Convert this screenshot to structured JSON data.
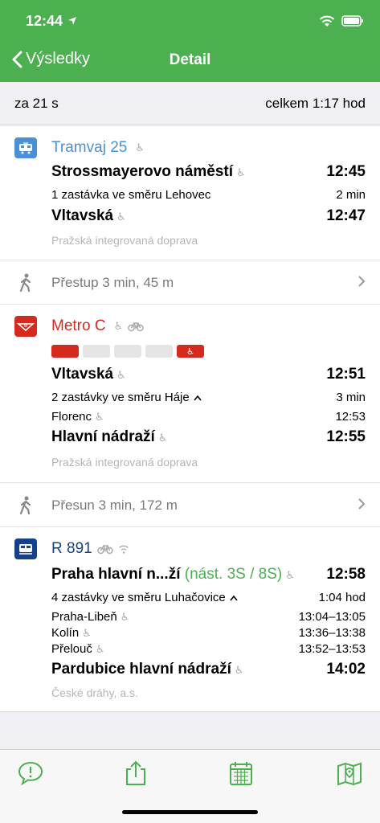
{
  "status": {
    "time": "12:44"
  },
  "nav": {
    "back_label": "Výsledky",
    "title": "Detail"
  },
  "summary": {
    "departure_in": "za 21 s",
    "total": "celkem 1:17 hod"
  },
  "legs": [
    {
      "type": "tram",
      "line": "Tramvaj 25",
      "line_color": "#4a90d9",
      "from": "Strossmayerovo náměstí",
      "from_time": "12:45",
      "stops_info": "1 zastávka ve směru Lehovec",
      "duration": "2 min",
      "to": "Vltavská",
      "to_time": "12:47",
      "operator": "Pražská integrovaná doprava"
    },
    {
      "type": "metro",
      "line": "Metro C",
      "line_color": "#d52b1e",
      "from": "Vltavská",
      "from_time": "12:51",
      "stops_info": "2 zastávky ve směru Háje",
      "duration": "3 min",
      "intermediate": [
        {
          "name": "Florenc",
          "time": "12:53"
        }
      ],
      "to": "Hlavní nádraží",
      "to_time": "12:55",
      "operator": "Pražská integrovaná doprava"
    },
    {
      "type": "train",
      "line": "R 891",
      "line_color": "#14428a",
      "from": "Praha hlavní n...ží",
      "platform": "(nást. 3S / 8S)",
      "from_time": "12:58",
      "stops_info": "4 zastávky ve směru Luhačovice",
      "duration": "1:04 hod",
      "intermediate": [
        {
          "name": "Praha-Libeň",
          "time": "13:04–13:05"
        },
        {
          "name": "Kolín",
          "time": "13:36–13:38"
        },
        {
          "name": "Přelouč",
          "time": "13:52–13:53"
        }
      ],
      "to": "Pardubice hlavní nádraží",
      "to_time": "14:02",
      "operator": "České dráhy, a.s."
    }
  ],
  "transfers": [
    {
      "text": "Přestup 3 min, 45 m"
    },
    {
      "text": "Přesun 3 min, 172 m"
    }
  ],
  "accent": "#4caf50"
}
